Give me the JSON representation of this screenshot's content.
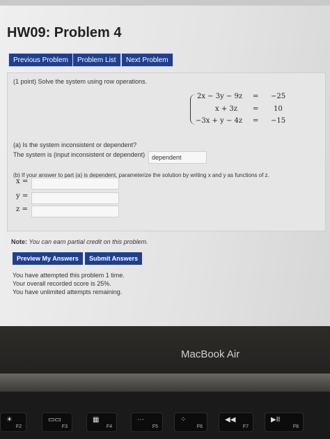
{
  "page": {
    "title": "HW09: Problem 4"
  },
  "nav": {
    "previous": "Previous Problem",
    "list": "Problem List",
    "next": "Next Problem"
  },
  "problem": {
    "statement": "(1 point) Solve the system using row operations.",
    "system": [
      {
        "lhs": "2x − 3y − 9z",
        "eq": "=",
        "rhs": "−25"
      },
      {
        "lhs": "x + 3z",
        "eq": "=",
        "rhs": "10"
      },
      {
        "lhs": "−3x + y − 4z",
        "eq": "=",
        "rhs": "−15"
      }
    ],
    "part_a_question": "(a) Is the system inconsistent or dependent?",
    "part_a_prompt": "The system is (input inconsistent or dependent)",
    "part_a_answer": "dependent",
    "part_b_question": "(b) If your answer to part (a) is dependent, parameterize the solution by writing x and y as functions of z.",
    "labels": {
      "x": "x =",
      "y": "y =",
      "z": "z ="
    },
    "note_label": "Note:",
    "note_text": "You can earn partial credit on this problem."
  },
  "actions": {
    "preview": "Preview My Answers",
    "submit": "Submit Answers"
  },
  "status": {
    "attempts": "You have attempted this problem 1 time.",
    "score": "Your overall recorded score is 25%.",
    "remaining": "You have unlimited attempts remaining."
  },
  "device": {
    "brand": "MacBook Air"
  },
  "keyboard": [
    {
      "glyph": "☀",
      "label": "F2",
      "icon": "brightness-up-icon"
    },
    {
      "glyph": "▭▭",
      "label": "F3",
      "icon": "mission-control-icon"
    },
    {
      "glyph": "▦",
      "label": "F4",
      "icon": "launchpad-icon"
    },
    {
      "glyph": "⋯",
      "label": "F5",
      "icon": "keyboard-light-down-icon"
    },
    {
      "glyph": "⁘",
      "label": "F6",
      "icon": "keyboard-light-up-icon"
    },
    {
      "glyph": "◀◀",
      "label": "F7",
      "icon": "rewind-icon"
    },
    {
      "glyph": "▶II",
      "label": "F8",
      "icon": "play-pause-icon"
    }
  ]
}
